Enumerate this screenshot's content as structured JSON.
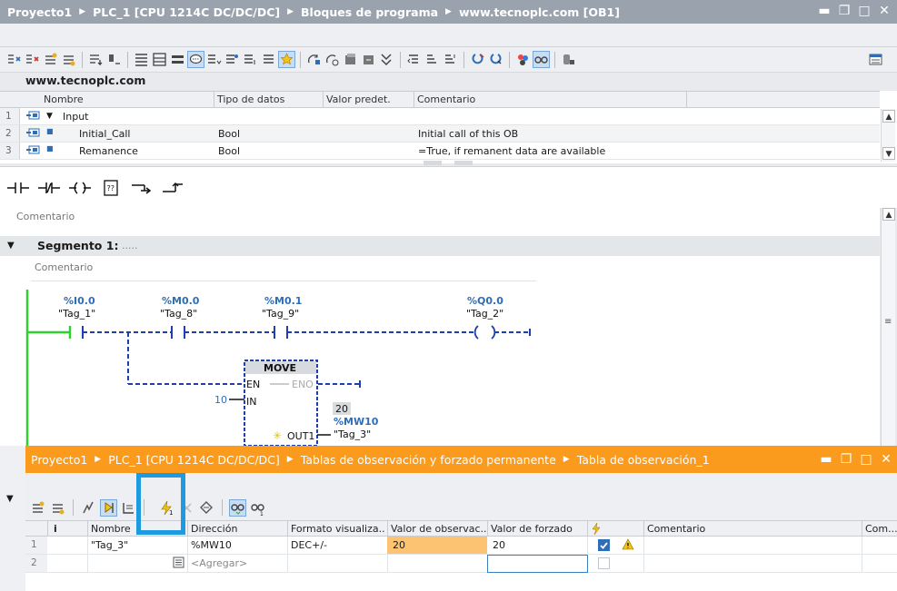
{
  "titlebar": {
    "crumbs": [
      "Proyecto1",
      "PLC_1 [CPU 1214C DC/DC/DC]",
      "Bloques de programa",
      "www.tecnoplc.com [OB1]"
    ]
  },
  "site_label": "www.tecnoplc.com",
  "interface_table": {
    "headers": [
      "Nombre",
      "Tipo de datos",
      "Valor predet.",
      "Comentario"
    ],
    "rows": [
      {
        "num": "1",
        "name": "Input",
        "type": "",
        "default": "",
        "comment": ""
      },
      {
        "num": "2",
        "name": "Initial_Call",
        "type": "Bool",
        "default": "",
        "comment": "Initial call of this OB"
      },
      {
        "num": "3",
        "name": "Remanence",
        "type": "Bool",
        "default": "",
        "comment": "=True, if remanent data are available"
      }
    ]
  },
  "editor": {
    "block_comment": "Comentario",
    "segment_title": "Segmento 1:",
    "segment_dots": ".....",
    "segment_comment": "Comentario",
    "contacts": [
      {
        "address": "%I0.0",
        "tag": "\"Tag_1\""
      },
      {
        "address": "%M0.0",
        "tag": "\"Tag_8\""
      },
      {
        "address": "%M0.1",
        "tag": "\"Tag_9\""
      }
    ],
    "coil": {
      "address": "%Q0.0",
      "tag": "\"Tag_2\""
    },
    "move_box": {
      "title": "MOVE",
      "en": "EN",
      "eno": "ENO",
      "in_label": "IN",
      "in_value": "10",
      "out_label": "OUT1",
      "out_value": "20",
      "out_address": "%MW10",
      "out_tag": "\"Tag_3\""
    }
  },
  "watch_panel": {
    "crumbs": [
      "Proyecto1",
      "PLC_1 [CPU 1214C DC/DC/DC]",
      "Tablas de observación y forzado permanente",
      "Tabla de observación_1"
    ],
    "headers": {
      "info": "i",
      "name": "Nombre",
      "address": "Dirección",
      "format": "Formato visualiza..",
      "monitor": "Valor de observac..",
      "force_value": "Valor de forzado",
      "comment": "Comentario",
      "extra": "Com..."
    },
    "rows": [
      {
        "num": "1",
        "name": "\"Tag_3\"",
        "address": "%MW10",
        "format": "DEC+/-",
        "monitor": "20",
        "force_value": "20",
        "force_checked": true
      },
      {
        "num": "2",
        "name": "",
        "address": "<Agregar>",
        "format": "",
        "monitor": "",
        "force_value": "",
        "force_checked": false
      }
    ]
  },
  "colors": {
    "watch_title_bg": "#fb9b1e",
    "highlight": "#1e9be0",
    "monitor_cell": "#fcc372",
    "ladder_blue": "#1f3fb0",
    "power_rail": "#2ed12e"
  }
}
